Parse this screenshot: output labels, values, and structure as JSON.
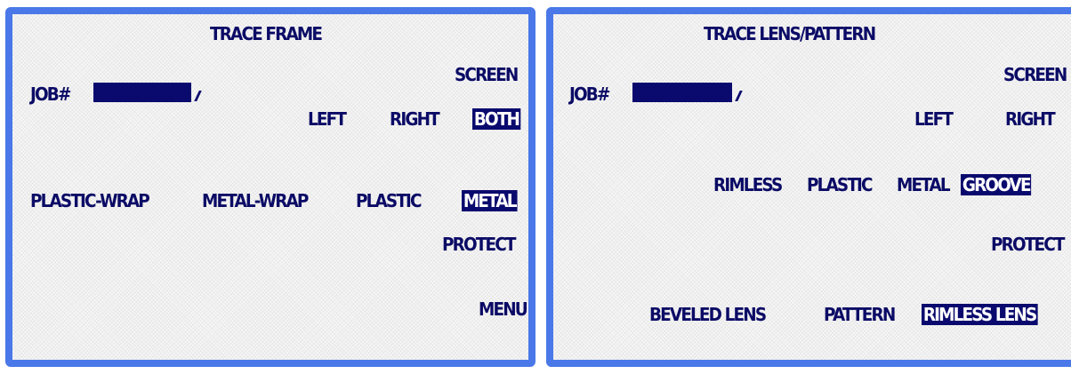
{
  "left_panel": {
    "title": "TRACE FRAME",
    "job_label": "JOB#",
    "job_value": "",
    "screen_label": "SCREEN",
    "eye_options": [
      "LEFT",
      "RIGHT",
      "BOTH"
    ],
    "eye_selected": "BOTH",
    "frame_options": [
      "PLASTIC-WRAP",
      "METAL-WRAP",
      "PLASTIC",
      "METAL"
    ],
    "frame_selected": "METAL",
    "protect_label": "PROTECT",
    "menu_label": "MENU"
  },
  "right_panel": {
    "title": "TRACE LENS/PATTERN",
    "job_label": "JOB#",
    "job_value": "",
    "screen_label": "SCREEN",
    "eye_options": [
      "LEFT",
      "RIGHT"
    ],
    "frame_options": [
      "RIMLESS",
      "PLASTIC",
      "METAL",
      "GROOVE"
    ],
    "frame_selected": "GROOVE",
    "protect_label": "PROTECT",
    "pattern_options": [
      "BEVELED LENS",
      "PATTERN",
      "RIMLESS LENS"
    ],
    "pattern_selected": "RIMLESS LENS"
  },
  "colors": {
    "border": "#4a78e8",
    "text": "#0b0b66",
    "highlight": "#0a0a6e",
    "background": "#f6f6f6"
  }
}
